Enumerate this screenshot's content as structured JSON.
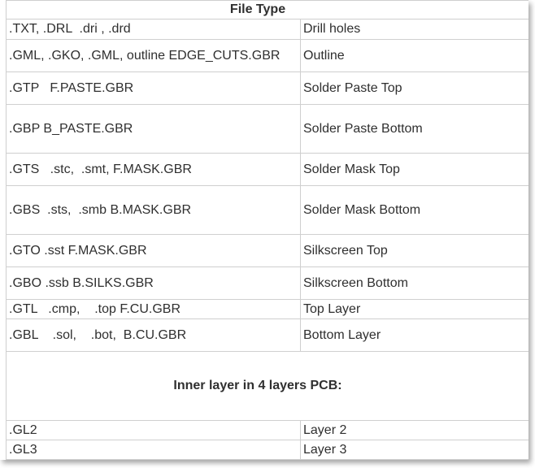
{
  "header": {
    "title": "File Type"
  },
  "rows_top": [
    {
      "ext": ".TXT, .DRL  .dri , .drd",
      "type": "Drill holes"
    },
    {
      "ext": ".GML, .GKO, .GML, outline EDGE_CUTS.GBR",
      "type": "Outline"
    },
    {
      "ext": ".GTP   F.PASTE.GBR",
      "type": "Solder Paste Top"
    },
    {
      "ext": ".GBP B_PASTE.GBR",
      "type": "Solder Paste Bottom"
    },
    {
      "ext": ".GTS   .stc,  .smt, F.MASK.GBR",
      "type": "Solder Mask Top"
    },
    {
      "ext": ".GBS  .sts,  .smb B.MASK.GBR",
      "type": "Solder Mask Bottom"
    },
    {
      "ext": ".GTO .sst F.MASK.GBR",
      "type": "Silkscreen Top"
    },
    {
      "ext": ".GBO .ssb B.SILKS.GBR",
      "type": "Silkscreen Bottom"
    },
    {
      "ext": ".GTL   .cmp,    .top F.CU.GBR",
      "type": "Top Layer"
    },
    {
      "ext": ".GBL    .sol,    .bot,  B.CU.GBR",
      "type": "Bottom Layer"
    }
  ],
  "section": {
    "title": "Inner layer in 4 layers PCB:"
  },
  "rows_inner": [
    {
      "ext": ".GL2",
      "type": "Layer 2"
    },
    {
      "ext": ".GL3",
      "type": "Layer 3"
    }
  ]
}
